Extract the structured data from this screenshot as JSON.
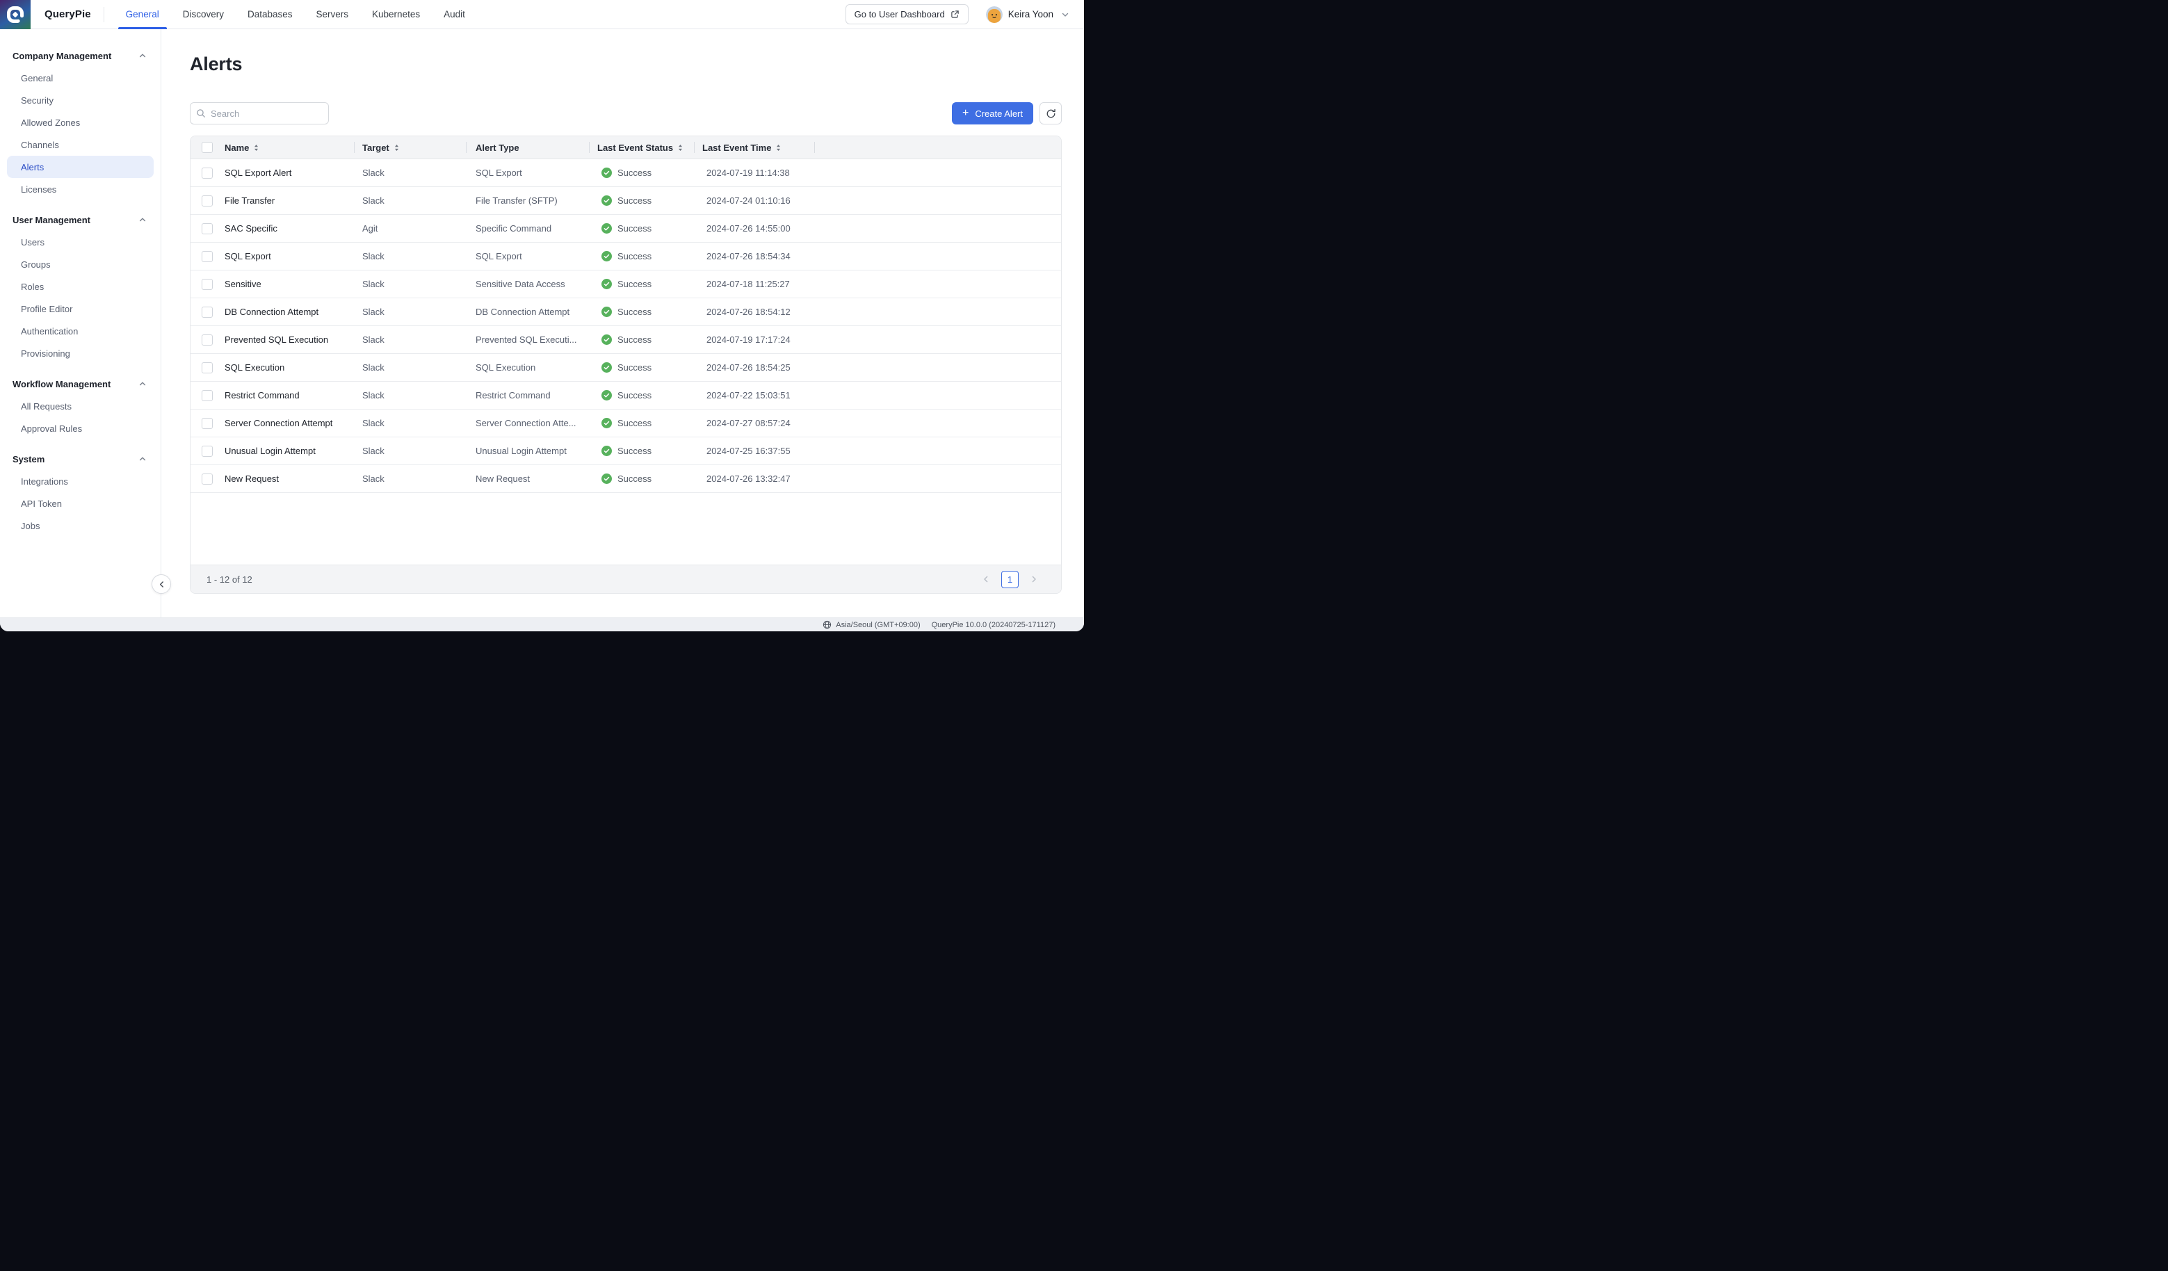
{
  "colors": {
    "accent": "#3e6ee3",
    "accent-bright": "#2d5fe6",
    "accent-deep": "#2c4ec6",
    "active-bg": "#e8eefb",
    "success": "#57b15c",
    "dark-edge": "#0a0c14"
  },
  "icons": {
    "search": "magnifier",
    "plus": "+",
    "refresh": "circular-arrow",
    "external-link": "box-arrow",
    "chevron-up": "^",
    "chevron-down": "v",
    "chevron-left": "<",
    "chevron-right": ">",
    "sort": "double-triangle",
    "status-success": "check-circle",
    "globe": "globe"
  },
  "header": {
    "brand": "QueryPie",
    "tabs": [
      {
        "label": "General",
        "active": true
      },
      {
        "label": "Discovery",
        "active": false
      },
      {
        "label": "Databases",
        "active": false
      },
      {
        "label": "Servers",
        "active": false
      },
      {
        "label": "Kubernetes",
        "active": false
      },
      {
        "label": "Audit",
        "active": false
      }
    ],
    "dashboard_button": "Go to User Dashboard",
    "user_name": "Keira Yoon"
  },
  "sidebar": {
    "sections": [
      {
        "title": "Company Management",
        "items": [
          {
            "label": "General"
          },
          {
            "label": "Security"
          },
          {
            "label": "Allowed Zones"
          },
          {
            "label": "Channels"
          },
          {
            "label": "Alerts",
            "active": true
          },
          {
            "label": "Licenses"
          }
        ]
      },
      {
        "title": "User Management",
        "items": [
          {
            "label": "Users"
          },
          {
            "label": "Groups"
          },
          {
            "label": "Roles"
          },
          {
            "label": "Profile Editor"
          },
          {
            "label": "Authentication"
          },
          {
            "label": "Provisioning"
          }
        ]
      },
      {
        "title": "Workflow Management",
        "items": [
          {
            "label": "All Requests"
          },
          {
            "label": "Approval Rules"
          }
        ]
      },
      {
        "title": "System",
        "items": [
          {
            "label": "Integrations"
          },
          {
            "label": "API Token"
          },
          {
            "label": "Jobs"
          }
        ]
      }
    ]
  },
  "main": {
    "title": "Alerts",
    "search_placeholder": "Search",
    "create_button": "Create Alert",
    "table": {
      "columns": [
        {
          "label": "Name",
          "sortable": true
        },
        {
          "label": "Target",
          "sortable": true
        },
        {
          "label": "Alert Type",
          "sortable": false
        },
        {
          "label": "Last Event Status",
          "sortable": true
        },
        {
          "label": "Last Event Time",
          "sortable": true
        }
      ],
      "rows": [
        {
          "name": "SQL Export Alert",
          "target": "Slack",
          "alert_type": "SQL Export",
          "status": "Success",
          "time": "2024-07-19 11:14:38"
        },
        {
          "name": "File Transfer",
          "target": "Slack",
          "alert_type": "File Transfer (SFTP)",
          "status": "Success",
          "time": "2024-07-24 01:10:16"
        },
        {
          "name": "SAC Specific",
          "target": "Agit",
          "alert_type": "Specific Command",
          "status": "Success",
          "time": "2024-07-26 14:55:00"
        },
        {
          "name": "SQL Export",
          "target": "Slack",
          "alert_type": "SQL Export",
          "status": "Success",
          "time": "2024-07-26 18:54:34"
        },
        {
          "name": "Sensitive",
          "target": "Slack",
          "alert_type": "Sensitive Data Access",
          "status": "Success",
          "time": "2024-07-18 11:25:27"
        },
        {
          "name": "DB Connection Attempt",
          "target": "Slack",
          "alert_type": "DB Connection Attempt",
          "status": "Success",
          "time": "2024-07-26 18:54:12"
        },
        {
          "name": "Prevented SQL Execution",
          "target": "Slack",
          "alert_type": "Prevented SQL Executi...",
          "status": "Success",
          "time": "2024-07-19 17:17:24"
        },
        {
          "name": "SQL Execution",
          "target": "Slack",
          "alert_type": "SQL Execution",
          "status": "Success",
          "time": "2024-07-26 18:54:25"
        },
        {
          "name": "Restrict Command",
          "target": "Slack",
          "alert_type": "Restrict Command",
          "status": "Success",
          "time": "2024-07-22 15:03:51"
        },
        {
          "name": "Server Connection Attempt",
          "target": "Slack",
          "alert_type": "Server Connection Atte...",
          "status": "Success",
          "time": "2024-07-27 08:57:24"
        },
        {
          "name": "Unusual Login Attempt",
          "target": "Slack",
          "alert_type": "Unusual Login Attempt",
          "status": "Success",
          "time": "2024-07-25 16:37:55"
        },
        {
          "name": "New Request",
          "target": "Slack",
          "alert_type": "New Request",
          "status": "Success",
          "time": "2024-07-26 13:32:47"
        }
      ]
    },
    "pagination": {
      "range": "1 - 12 of 12",
      "page": "1"
    }
  },
  "statusbar": {
    "timezone": "Asia/Seoul (GMT+09:00)",
    "version": "QueryPie 10.0.0 (20240725-171127)"
  }
}
